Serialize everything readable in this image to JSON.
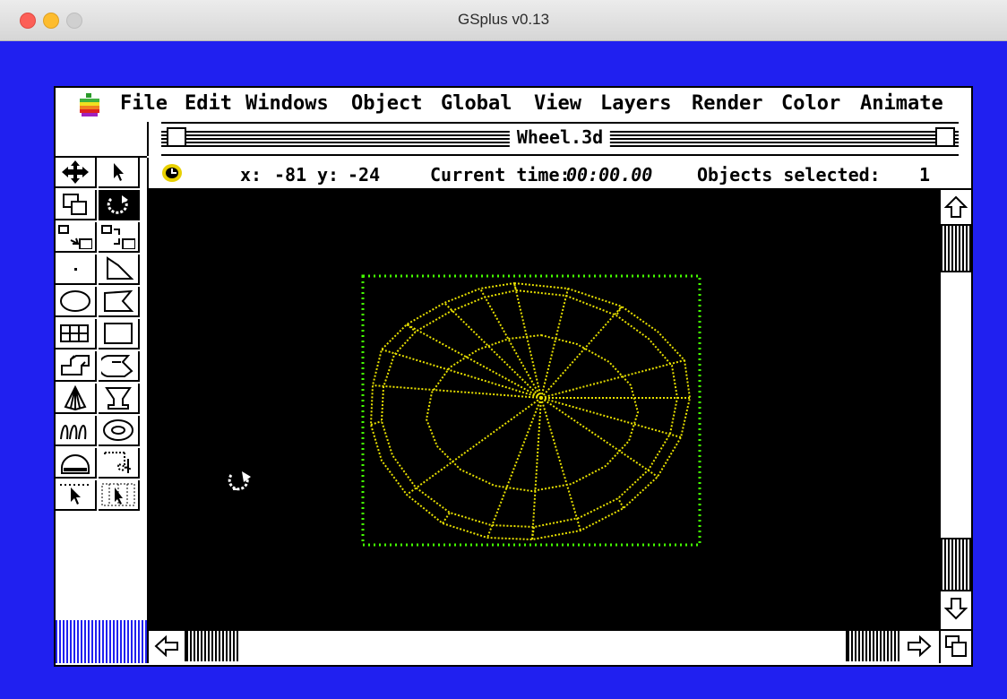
{
  "window": {
    "title": "GSplus v0.13"
  },
  "menubar": {
    "items": [
      "File",
      "Edit",
      "Windows",
      "Object",
      "Global",
      "View",
      "Layers",
      "Render",
      "Color",
      "Animate"
    ]
  },
  "document": {
    "title": "Wheel.3d"
  },
  "status": {
    "x_label": "x:",
    "x_value": "-81",
    "y_label": "y:",
    "y_value": "-24",
    "time_label": "Current time:",
    "time_value": "00:00.00",
    "selected_label": "Objects selected:",
    "selected_value": "1"
  },
  "colors": {
    "desktop": "#2020f0",
    "wireframe": "#e8e000",
    "selection_box": "#44ff00"
  },
  "icons": {
    "tools": [
      "move-icon",
      "arrow-pointer-icon",
      "group-icon",
      "rotate-icon",
      "scale-icon",
      "scale-uniform-icon",
      "point-icon",
      "polyline-icon",
      "ellipse-icon",
      "polygon-icon",
      "grid-icon",
      "rectangle-icon",
      "extrude-icon",
      "lathe-icon",
      "cone-icon",
      "goblet-icon",
      "spring-icon",
      "torus-icon",
      "dome-icon",
      "fillet-icon",
      "select-region-icon",
      "select-grid-icon"
    ]
  }
}
